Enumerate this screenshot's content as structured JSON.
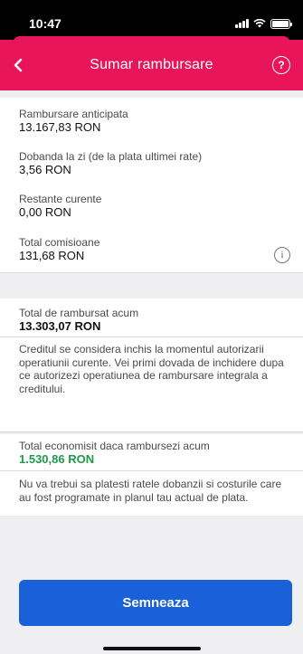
{
  "status_bar": {
    "time": "10:47"
  },
  "header": {
    "title": "Sumar rambursare",
    "back_icon": "chevron-left-icon",
    "help_icon": "help-circle-icon",
    "help_glyph": "?",
    "background": "#e8155b"
  },
  "summary": {
    "items": [
      {
        "label": "Rambursare anticipata",
        "value": "13.167,83 RON"
      },
      {
        "label": "Dobanda la zi (de la plata ultimei rate)",
        "value": "3,56 RON"
      },
      {
        "label": "Restante curente",
        "value": "0,00 RON"
      },
      {
        "label": "Total comisioane",
        "value": "131,68 RON"
      }
    ],
    "info_glyph": "i"
  },
  "total": {
    "label": "Total de rambursat acum",
    "value": "13.303,07 RON",
    "note": "Creditul se considera inchis la momentul autorizarii operatiunii curente. Vei primi dovada de inchidere dupa ce autorizezi operatiunea de rambursare integrala a creditului."
  },
  "savings": {
    "label": "Total economisit daca rambursezi acum",
    "value": "1.530,86 RON",
    "value_color": "#1f9a4a",
    "note": "Nu va trebui sa platesti ratele dobanzii si costurile care au fost programate in planul tau actual de plata."
  },
  "actions": {
    "sign_label": "Semneaza",
    "button_color": "#1a60d9"
  }
}
